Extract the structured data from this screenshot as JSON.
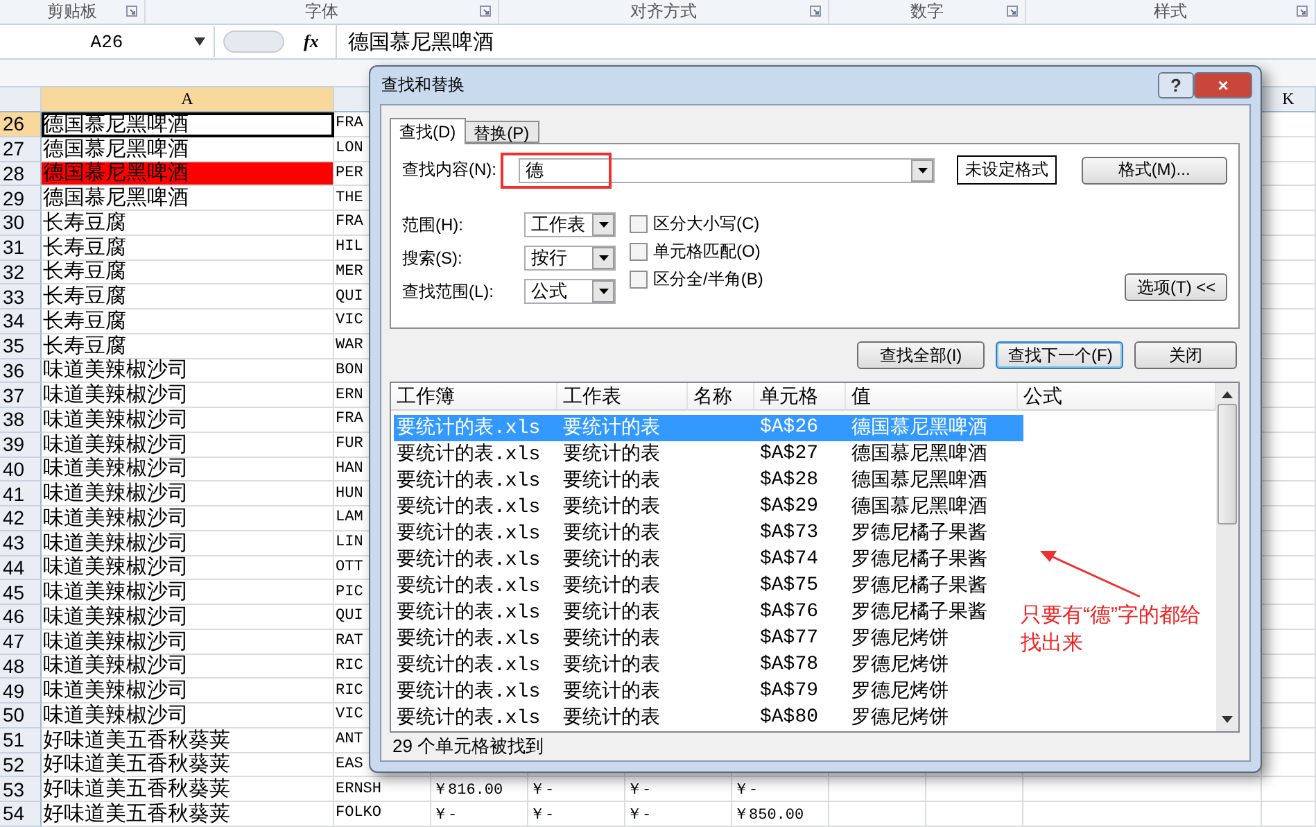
{
  "ribbon": {
    "groups": [
      "剪贴板",
      "字体",
      "对齐方式",
      "数字",
      "样式"
    ]
  },
  "formula_bar": {
    "name_box": "A26",
    "fx": "fx",
    "value": "德国慕尼黑啤酒"
  },
  "sheet": {
    "column_headers": [
      {
        "label": "A",
        "selected": true
      },
      {
        "label": "K",
        "selected": false
      }
    ],
    "rows": [
      {
        "number": "26",
        "selected": true,
        "color": "#ffffff",
        "cells": [
          "德国慕尼黑啤酒",
          "FRA"
        ]
      },
      {
        "number": "27",
        "selected": false,
        "color": "#ffffff",
        "cells": [
          "德国慕尼黑啤酒",
          "LON"
        ]
      },
      {
        "number": "28",
        "selected": false,
        "color": "#ff0000",
        "cells": [
          "德国慕尼黑啤酒",
          "PER"
        ]
      },
      {
        "number": "29",
        "selected": false,
        "color": "#ffffff",
        "cells": [
          "德国慕尼黑啤酒",
          "THE"
        ]
      },
      {
        "number": "30",
        "selected": false,
        "color": "#ffffff",
        "cells": [
          "长寿豆腐",
          "FRA"
        ]
      },
      {
        "number": "31",
        "selected": false,
        "color": "#ffffff",
        "cells": [
          "长寿豆腐",
          "HIL"
        ]
      },
      {
        "number": "32",
        "selected": false,
        "color": "#ffffff",
        "cells": [
          "长寿豆腐",
          "MER"
        ]
      },
      {
        "number": "33",
        "selected": false,
        "color": "#ffffff",
        "cells": [
          "长寿豆腐",
          "QUI"
        ]
      },
      {
        "number": "34",
        "selected": false,
        "color": "#ffffff",
        "cells": [
          "长寿豆腐",
          "VIC"
        ]
      },
      {
        "number": "35",
        "selected": false,
        "color": "#ffffff",
        "cells": [
          "长寿豆腐",
          "WAR"
        ]
      },
      {
        "number": "36",
        "selected": false,
        "color": "#ffffff",
        "cells": [
          "味道美辣椒沙司",
          "BON"
        ]
      },
      {
        "number": "37",
        "selected": false,
        "color": "#ffffff",
        "cells": [
          "味道美辣椒沙司",
          "ERN"
        ]
      },
      {
        "number": "38",
        "selected": false,
        "color": "#ffffff",
        "cells": [
          "味道美辣椒沙司",
          "FRA"
        ]
      },
      {
        "number": "39",
        "selected": false,
        "color": "#ffffff",
        "cells": [
          "味道美辣椒沙司",
          "FUR"
        ]
      },
      {
        "number": "40",
        "selected": false,
        "color": "#ffffff",
        "cells": [
          "味道美辣椒沙司",
          "HAN"
        ]
      },
      {
        "number": "41",
        "selected": false,
        "color": "#ffffff",
        "cells": [
          "味道美辣椒沙司",
          "HUN"
        ]
      },
      {
        "number": "42",
        "selected": false,
        "color": "#ffffff",
        "cells": [
          "味道美辣椒沙司",
          "LAM"
        ]
      },
      {
        "number": "43",
        "selected": false,
        "color": "#ffffff",
        "cells": [
          "味道美辣椒沙司",
          "LIN"
        ]
      },
      {
        "number": "44",
        "selected": false,
        "color": "#ffffff",
        "cells": [
          "味道美辣椒沙司",
          "OTT"
        ]
      },
      {
        "number": "45",
        "selected": false,
        "color": "#ffffff",
        "cells": [
          "味道美辣椒沙司",
          "PIC"
        ]
      },
      {
        "number": "46",
        "selected": false,
        "color": "#ffffff",
        "cells": [
          "味道美辣椒沙司",
          "QUI"
        ]
      },
      {
        "number": "47",
        "selected": false,
        "color": "#ffffff",
        "cells": [
          "味道美辣椒沙司",
          "RAT"
        ]
      },
      {
        "number": "48",
        "selected": false,
        "color": "#ffffff",
        "cells": [
          "味道美辣椒沙司",
          "RIC"
        ]
      },
      {
        "number": "49",
        "selected": false,
        "color": "#ffffff",
        "cells": [
          "味道美辣椒沙司",
          "RIC"
        ]
      },
      {
        "number": "50",
        "selected": false,
        "color": "#ffffff",
        "cells": [
          "味道美辣椒沙司",
          "VIC"
        ]
      },
      {
        "number": "51",
        "selected": false,
        "color": "#ffffff",
        "cells": [
          "好味道美五香秋葵荚",
          "ANT"
        ]
      },
      {
        "number": "52",
        "selected": false,
        "color": "#ffffff",
        "cells": [
          "好味道美五香秋葵荚",
          "EAS"
        ]
      },
      {
        "number": "53",
        "selected": false,
        "color": "#ffffff",
        "cells": [
          "好味道美五香秋葵荚",
          "ERNSH",
          "￥816.00",
          "￥-",
          "￥-",
          "￥-"
        ]
      },
      {
        "number": "54",
        "selected": false,
        "color": "#ffffff",
        "cells": [
          "好味道美五香秋葵荚",
          "FOLKO",
          "￥-",
          "￥-",
          "￥-",
          "￥850.00"
        ]
      }
    ]
  },
  "dialog": {
    "title": "查找和替换",
    "help": "?",
    "close": "×",
    "tabs": [
      {
        "label": "查找(D)",
        "selected": true
      },
      {
        "label": "替换(P)",
        "selected": false
      }
    ],
    "find_what": {
      "label": "查找内容(N):",
      "value": "德"
    },
    "format_status": "未设定格式",
    "format_button": "格式(M)...",
    "selects": [
      {
        "label": "范围(H):",
        "value": "工作表"
      },
      {
        "label": "搜索(S):",
        "value": "按行"
      },
      {
        "label": "查找范围(L):",
        "value": "公式"
      }
    ],
    "checkboxes": [
      {
        "label": "区分大小写(C)",
        "checked": false
      },
      {
        "label": "单元格匹配(O)",
        "checked": false
      },
      {
        "label": "区分全/半角(B)",
        "checked": false
      }
    ],
    "options_button": "选项(T) <<",
    "buttons": [
      "查找全部(I)",
      "查找下一个(F)",
      "关闭"
    ],
    "results": {
      "columns": [
        "工作簿",
        "工作表",
        "名称",
        "单元格",
        "值",
        "公式"
      ],
      "rows": [
        {
          "selected": true,
          "cells": [
            "要统计的表.xls",
            "要统计的表",
            "",
            "$A$26",
            "德国慕尼黑啤酒",
            ""
          ]
        },
        {
          "selected": false,
          "cells": [
            "要统计的表.xls",
            "要统计的表",
            "",
            "$A$27",
            "德国慕尼黑啤酒",
            ""
          ]
        },
        {
          "selected": false,
          "cells": [
            "要统计的表.xls",
            "要统计的表",
            "",
            "$A$28",
            "德国慕尼黑啤酒",
            ""
          ]
        },
        {
          "selected": false,
          "cells": [
            "要统计的表.xls",
            "要统计的表",
            "",
            "$A$29",
            "德国慕尼黑啤酒",
            ""
          ]
        },
        {
          "selected": false,
          "cells": [
            "要统计的表.xls",
            "要统计的表",
            "",
            "$A$73",
            "罗德尼橘子果酱",
            ""
          ]
        },
        {
          "selected": false,
          "cells": [
            "要统计的表.xls",
            "要统计的表",
            "",
            "$A$74",
            "罗德尼橘子果酱",
            ""
          ]
        },
        {
          "selected": false,
          "cells": [
            "要统计的表.xls",
            "要统计的表",
            "",
            "$A$75",
            "罗德尼橘子果酱",
            ""
          ]
        },
        {
          "selected": false,
          "cells": [
            "要统计的表.xls",
            "要统计的表",
            "",
            "$A$76",
            "罗德尼橘子果酱",
            ""
          ]
        },
        {
          "selected": false,
          "cells": [
            "要统计的表.xls",
            "要统计的表",
            "",
            "$A$77",
            "罗德尼烤饼",
            ""
          ]
        },
        {
          "selected": false,
          "cells": [
            "要统计的表.xls",
            "要统计的表",
            "",
            "$A$78",
            "罗德尼烤饼",
            ""
          ]
        },
        {
          "selected": false,
          "cells": [
            "要统计的表.xls",
            "要统计的表",
            "",
            "$A$79",
            "罗德尼烤饼",
            ""
          ]
        },
        {
          "selected": false,
          "cells": [
            "要统计的表.xls",
            "要统计的表",
            "",
            "$A$80",
            "罗德尼烤饼",
            ""
          ]
        }
      ]
    },
    "status": "29 个单元格被找到"
  },
  "annotation": {
    "note": "只要有“德”字的都给找出来"
  }
}
